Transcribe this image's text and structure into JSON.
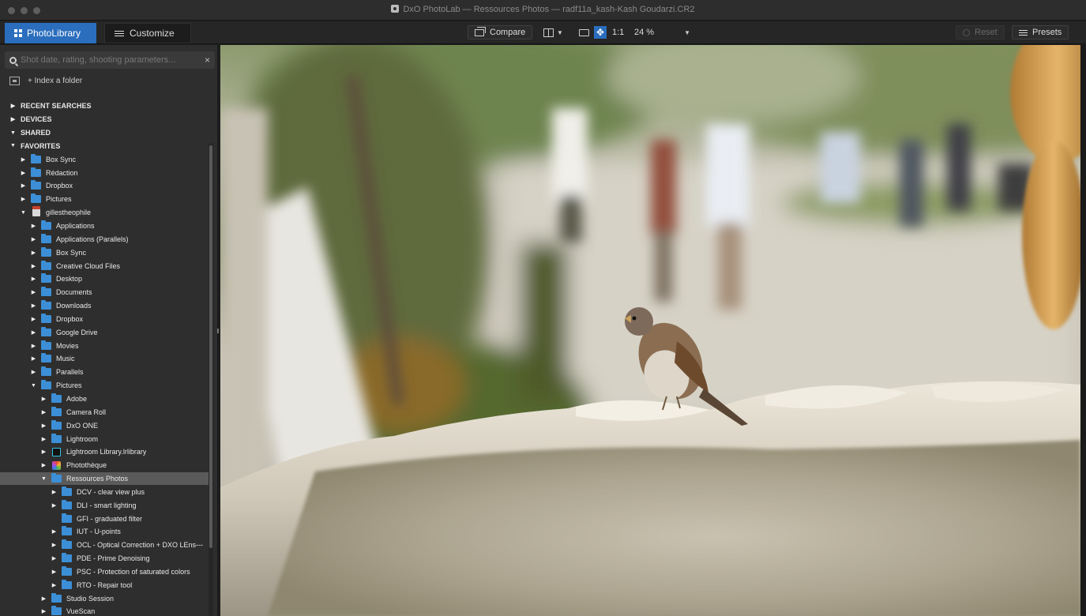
{
  "window": {
    "title": "DxO PhotoLab — Ressources Photos — radf11a_kash-Kash Goudarzi.CR2"
  },
  "tabs": {
    "photolibrary": "PhotoLibrary",
    "customize": "Customize"
  },
  "toolbar": {
    "compare": "Compare",
    "zoom_fit": "1:1",
    "zoom_value": "24 %",
    "reset": "Reset",
    "presets": "Presets"
  },
  "sidebar": {
    "search_placeholder": "Shot date, rating, shooting parameters...",
    "clear": "×",
    "index_folder": "+ Index a folder",
    "tree": [
      {
        "label": "RECENT SEARCHES",
        "level": 0,
        "state": "collapsed",
        "type": "section"
      },
      {
        "label": "DEVICES",
        "level": 0,
        "state": "collapsed",
        "type": "section"
      },
      {
        "label": "SHARED",
        "level": 0,
        "state": "expanded",
        "type": "section"
      },
      {
        "label": "FAVORITES",
        "level": 0,
        "state": "expanded",
        "type": "section"
      },
      {
        "label": "Box Sync",
        "level": 1,
        "state": "collapsed",
        "type": "folder"
      },
      {
        "label": "Rédaction",
        "level": 1,
        "state": "collapsed",
        "type": "folder"
      },
      {
        "label": "Dropbox",
        "level": 1,
        "state": "collapsed",
        "type": "folder"
      },
      {
        "label": "Pictures",
        "level": 1,
        "state": "collapsed",
        "type": "folder"
      },
      {
        "label": "gillestheophile",
        "level": 1,
        "state": "expanded",
        "type": "home"
      },
      {
        "label": "Applications",
        "level": 2,
        "state": "collapsed",
        "type": "folder"
      },
      {
        "label": "Applications (Parallels)",
        "level": 2,
        "state": "collapsed",
        "type": "folder"
      },
      {
        "label": "Box Sync",
        "level": 2,
        "state": "collapsed",
        "type": "folder"
      },
      {
        "label": "Creative Cloud Files",
        "level": 2,
        "state": "collapsed",
        "type": "folder"
      },
      {
        "label": "Desktop",
        "level": 2,
        "state": "collapsed",
        "type": "folder"
      },
      {
        "label": "Documents",
        "level": 2,
        "state": "collapsed",
        "type": "folder"
      },
      {
        "label": "Downloads",
        "level": 2,
        "state": "collapsed",
        "type": "folder"
      },
      {
        "label": "Dropbox",
        "level": 2,
        "state": "collapsed",
        "type": "folder"
      },
      {
        "label": "Google Drive",
        "level": 2,
        "state": "collapsed",
        "type": "folder"
      },
      {
        "label": "Movies",
        "level": 2,
        "state": "collapsed",
        "type": "folder"
      },
      {
        "label": "Music",
        "level": 2,
        "state": "collapsed",
        "type": "folder"
      },
      {
        "label": "Parallels",
        "level": 2,
        "state": "collapsed",
        "type": "folder"
      },
      {
        "label": "Pictures",
        "level": 2,
        "state": "expanded",
        "type": "folder"
      },
      {
        "label": "Adobe",
        "level": 3,
        "state": "collapsed",
        "type": "folder"
      },
      {
        "label": "Camera Roll",
        "level": 3,
        "state": "collapsed",
        "type": "folder"
      },
      {
        "label": "DxO ONE",
        "level": 3,
        "state": "collapsed",
        "type": "folder"
      },
      {
        "label": "Lightroom",
        "level": 3,
        "state": "collapsed",
        "type": "folder"
      },
      {
        "label": "Lightroom Library.lrlibrary",
        "level": 3,
        "state": "collapsed",
        "type": "lrlibrary"
      },
      {
        "label": "Photothèque",
        "level": 3,
        "state": "collapsed",
        "type": "photos"
      },
      {
        "label": "Ressources Photos",
        "level": 3,
        "state": "expanded",
        "type": "folder",
        "selected": true
      },
      {
        "label": "DCV - clear view plus",
        "level": 4,
        "state": "collapsed",
        "type": "folder"
      },
      {
        "label": "DLI - smart lighting",
        "level": 4,
        "state": "collapsed",
        "type": "folder"
      },
      {
        "label": "GFI - graduated filter",
        "level": 4,
        "state": "none",
        "type": "folder"
      },
      {
        "label": "IUT - U-points",
        "level": 4,
        "state": "collapsed",
        "type": "folder"
      },
      {
        "label": "OCL - Optical Correction + DXO LEns---",
        "level": 4,
        "state": "collapsed",
        "type": "folder"
      },
      {
        "label": "PDE - Prime Denoising",
        "level": 4,
        "state": "collapsed",
        "type": "folder"
      },
      {
        "label": "PSC - Protection of saturated colors",
        "level": 4,
        "state": "collapsed",
        "type": "folder"
      },
      {
        "label": "RTO - Repair tool",
        "level": 4,
        "state": "collapsed",
        "type": "folder"
      },
      {
        "label": "Studio Session",
        "level": 3,
        "state": "collapsed",
        "type": "folder"
      },
      {
        "label": "VueScan",
        "level": 3,
        "state": "collapsed",
        "type": "folder"
      }
    ]
  },
  "viewer": {
    "image": "sparrow perched on a stone fountain, blurred park background"
  },
  "colors": {
    "accent": "#2a6ebd",
    "folder": "#3c8fd6",
    "selection": "#5a5a5a"
  },
  "icons": {
    "photolibrary": "grid-icon",
    "customize": "sliders-icon",
    "compare": "compare-icon",
    "search": "search-icon"
  }
}
